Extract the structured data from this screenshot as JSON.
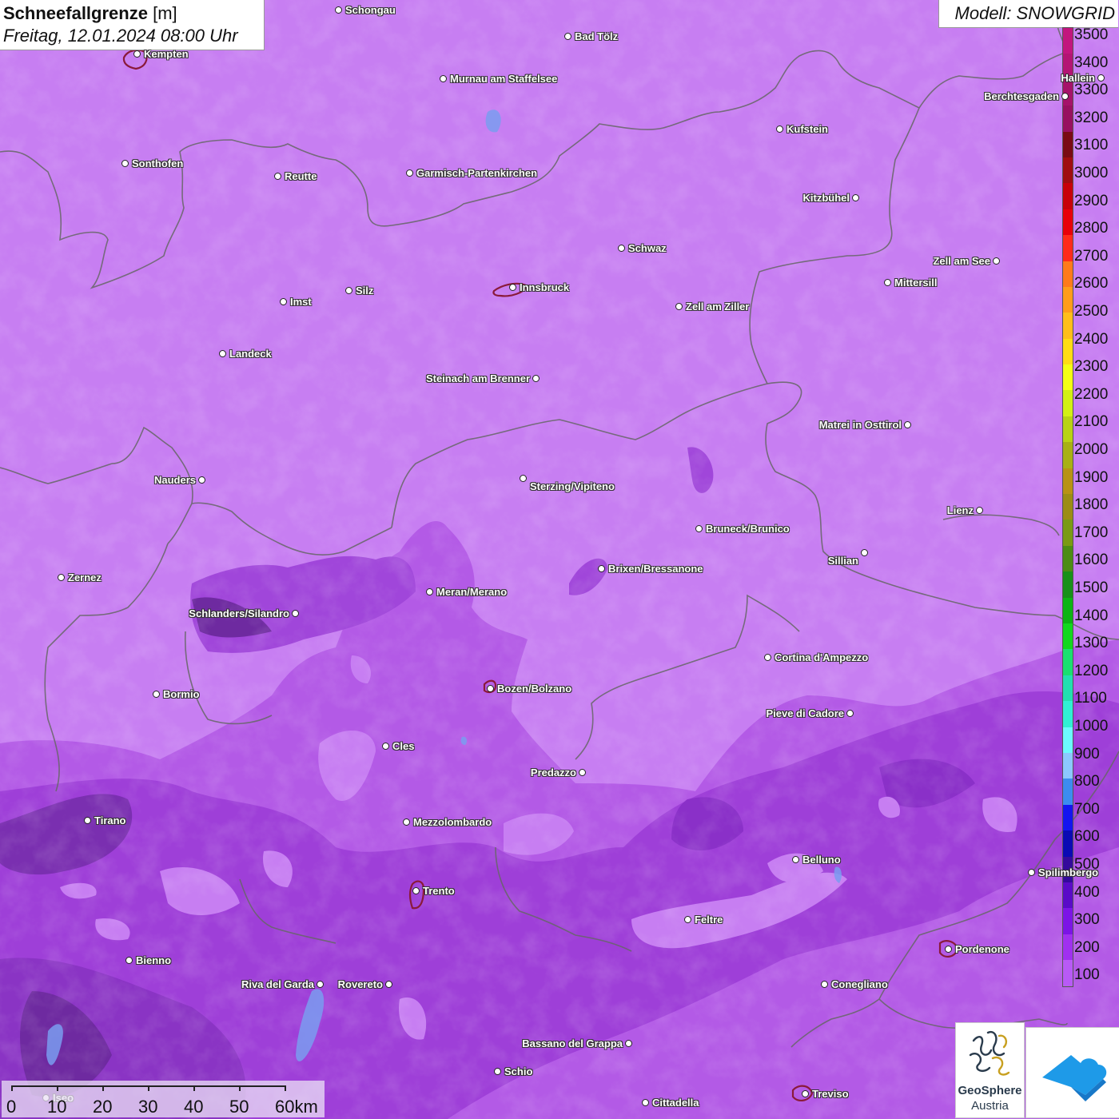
{
  "title": {
    "main": "Schneefallgrenze",
    "unit": "[m]",
    "date": "Freitag, 12.01.2024 08:00 Uhr"
  },
  "model": "Modell: SNOWGRID",
  "legend": {
    "labels": [
      "3500",
      "3400",
      "3300",
      "3200",
      "3100",
      "3000",
      "2900",
      "2800",
      "2700",
      "2600",
      "2500",
      "2400",
      "2300",
      "2200",
      "2100",
      "2000",
      "1900",
      "1800",
      "1700",
      "1600",
      "1500",
      "1400",
      "1300",
      "1200",
      "1100",
      "1000",
      "900",
      "800",
      "700",
      "600",
      "500",
      "400",
      "300",
      "200",
      "100"
    ],
    "colors": [
      "#c2157e",
      "#b41474",
      "#a6126a",
      "#981060",
      "#7a0a14",
      "#a00c10",
      "#c8000a",
      "#e8000a",
      "#ff2a1a",
      "#ff7a1a",
      "#ff9c1a",
      "#ffbe1a",
      "#ffdc14",
      "#f4ff14",
      "#d2f014",
      "#b8d214",
      "#a8b014",
      "#b89214",
      "#9c8c14",
      "#7a9a14",
      "#4c8c14",
      "#18901a",
      "#0cb414",
      "#12d81e",
      "#1ae070",
      "#22e0b0",
      "#30f0d4",
      "#6cfaff",
      "#8cc8ff",
      "#3c8cf0",
      "#1414f0",
      "#0a0ab4",
      "#340a9c",
      "#5a0ac8",
      "#7c14e6",
      "#a030f0",
      "#b85af6"
    ]
  },
  "cities": [
    {
      "name": "Schongau"
    },
    {
      "name": "Bad Tölz"
    },
    {
      "name": "Kempten"
    },
    {
      "name": "Murnau am Staffelsee"
    },
    {
      "name": "Hallein"
    },
    {
      "name": "Berchtesgaden"
    },
    {
      "name": "Kufstein"
    },
    {
      "name": "Sonthofen"
    },
    {
      "name": "Reutte"
    },
    {
      "name": "Garmisch-Partenkirchen"
    },
    {
      "name": "Kitzbühel"
    },
    {
      "name": "Schwaz"
    },
    {
      "name": "Zell am See"
    },
    {
      "name": "Innsbruck"
    },
    {
      "name": "Mittersill"
    },
    {
      "name": "Imst"
    },
    {
      "name": "Silz"
    },
    {
      "name": "Zell am Ziller"
    },
    {
      "name": "Landeck"
    },
    {
      "name": "Steinach am Brenner"
    },
    {
      "name": "Matrei in Osttirol"
    },
    {
      "name": "Nauders"
    },
    {
      "name": "Sterzing/Vipiteno"
    },
    {
      "name": "Lienz"
    },
    {
      "name": "Bruneck/Brunico"
    },
    {
      "name": "Sillian"
    },
    {
      "name": "Zernez"
    },
    {
      "name": "Brixen/Bressanone"
    },
    {
      "name": "Meran/Merano"
    },
    {
      "name": "Schlanders/Silandro"
    },
    {
      "name": "Cortina d'Ampezzo"
    },
    {
      "name": "Bozen/Bolzano"
    },
    {
      "name": "Bormio"
    },
    {
      "name": "Pieve di Cadore"
    },
    {
      "name": "Cles"
    },
    {
      "name": "Predazzo"
    },
    {
      "name": "Tirano"
    },
    {
      "name": "Mezzolombardo"
    },
    {
      "name": "Belluno"
    },
    {
      "name": "Spilimbergo"
    },
    {
      "name": "Trento"
    },
    {
      "name": "Feltre"
    },
    {
      "name": "Pordenone"
    },
    {
      "name": "Bienno"
    },
    {
      "name": "Riva del Garda"
    },
    {
      "name": "Rovereto"
    },
    {
      "name": "Conegliano"
    },
    {
      "name": "Bassano del Grappa"
    },
    {
      "name": "Schio"
    },
    {
      "name": "Treviso"
    },
    {
      "name": "Cittadella"
    },
    {
      "name": "Iseo"
    }
  ],
  "scale": {
    "labels": [
      "0",
      "10",
      "20",
      "30",
      "40",
      "50",
      "60km"
    ]
  },
  "logos": {
    "geosphere_line1": "GeoSphere",
    "geosphere_line2": "Austria"
  }
}
